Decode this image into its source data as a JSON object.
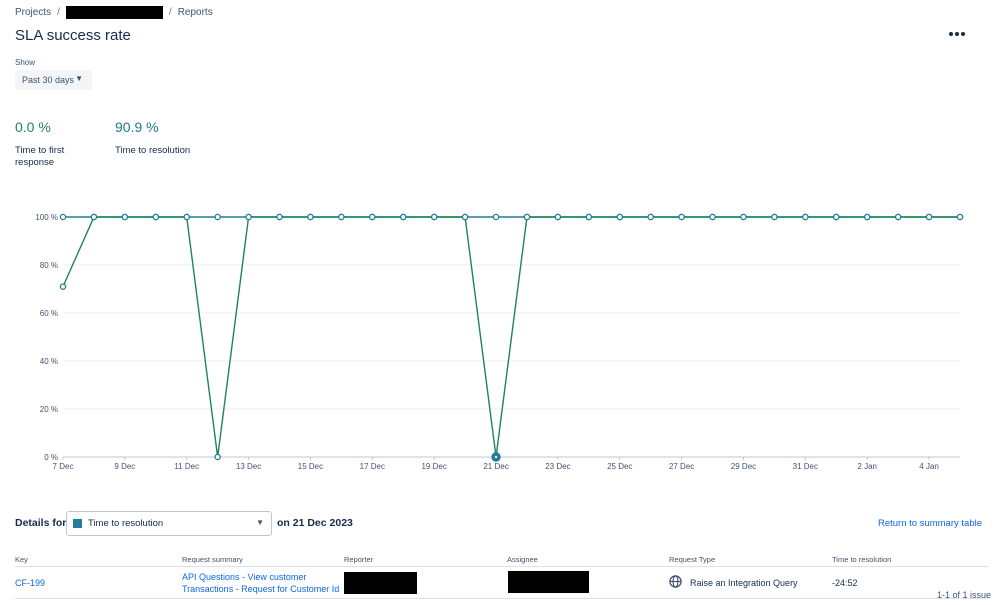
{
  "breadcrumb": {
    "projects": "Projects",
    "separator": "/",
    "reports": "Reports"
  },
  "page": {
    "title": "SLA success rate"
  },
  "filter": {
    "show_label": "Show",
    "range": "Past 30 days"
  },
  "metrics": [
    {
      "value": "0.0 %",
      "label": "Time to first response"
    },
    {
      "value": "90.9 %",
      "label": "Time to resolution"
    }
  ],
  "chart_data": {
    "type": "line",
    "x": [
      "7 Dec",
      "8 Dec",
      "9 Dec",
      "10 Dec",
      "11 Dec",
      "12 Dec",
      "13 Dec",
      "14 Dec",
      "15 Dec",
      "16 Dec",
      "17 Dec",
      "18 Dec",
      "19 Dec",
      "20 Dec",
      "21 Dec",
      "22 Dec",
      "23 Dec",
      "24 Dec",
      "25 Dec",
      "26 Dec",
      "27 Dec",
      "28 Dec",
      "29 Dec",
      "30 Dec",
      "31 Dec",
      "1 Jan",
      "2 Jan",
      "3 Jan",
      "4 Jan",
      "5 Jan"
    ],
    "xticks": [
      "7 Dec",
      "9 Dec",
      "11 Dec",
      "13 Dec",
      "15 Dec",
      "17 Dec",
      "19 Dec",
      "21 Dec",
      "23 Dec",
      "25 Dec",
      "27 Dec",
      "29 Dec",
      "31 Dec",
      "2 Jan",
      "4 Jan"
    ],
    "yticks": [
      "0 %",
      "20 %",
      "40 %",
      "60 %",
      "80 %",
      "100 %"
    ],
    "ylim": [
      0,
      100
    ],
    "grid": true,
    "series": [
      {
        "color": "#227d9b",
        "values": [
          100,
          100,
          100,
          100,
          100,
          100,
          100,
          100,
          100,
          100,
          100,
          100,
          100,
          100,
          100,
          100,
          100,
          100,
          100,
          100,
          100,
          100,
          100,
          100,
          100,
          100,
          100,
          100,
          100,
          100
        ]
      },
      {
        "color": "#1f845a",
        "values": [
          71,
          100,
          100,
          100,
          100,
          0,
          100,
          100,
          100,
          100,
          100,
          100,
          100,
          100,
          0,
          100,
          100,
          100,
          100,
          100,
          100,
          100,
          100,
          100,
          100,
          100,
          100,
          100,
          100,
          100
        ]
      }
    ],
    "selected_point": "21 Dec"
  },
  "details": {
    "label": "Details for",
    "selected": "Time to resolution",
    "date": "on 21 Dec 2023",
    "return_link": "Return to summary table",
    "swatch_color": "#227d9b"
  },
  "table": {
    "columns": [
      "Key",
      "Request summary",
      "Reporter",
      "Assignee",
      "Request Type",
      "Time to resolution"
    ],
    "rows": [
      {
        "key": "CF-199",
        "summary_line1": "API Questions - View customer",
        "summary_line2": "Transactions - Request for Customer Id",
        "request_type_icon": "globe-icon",
        "request_type": "Raise an Integration Query",
        "time_to_resolution": "-24:52"
      }
    ],
    "pagination": "1-1 of 1 issue"
  }
}
